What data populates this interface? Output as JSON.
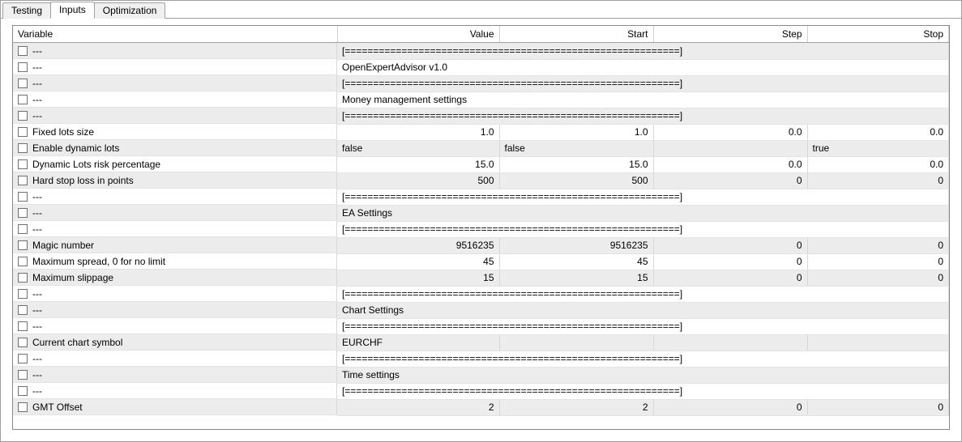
{
  "tabs": [
    {
      "label": "Testing",
      "active": false
    },
    {
      "label": "Inputs",
      "active": true
    },
    {
      "label": "Optimization",
      "active": false
    }
  ],
  "headers": {
    "variable": "Variable",
    "value": "Value",
    "start": "Start",
    "step": "Step",
    "stop": "Stop"
  },
  "sep": "[===========================================================]",
  "rows": [
    {
      "type": "sep",
      "variable": "---"
    },
    {
      "type": "text",
      "variable": "---",
      "value": "OpenExpertAdvisor v1.0"
    },
    {
      "type": "sep",
      "variable": "---"
    },
    {
      "type": "text",
      "variable": "---",
      "value": "Money management settings"
    },
    {
      "type": "sep",
      "variable": "---"
    },
    {
      "type": "num",
      "variable": "Fixed lots size",
      "value": "1.0",
      "start": "1.0",
      "step": "0.0",
      "stop": "0.0"
    },
    {
      "type": "bool",
      "variable": "Enable dynamic lots",
      "value": "false",
      "start": "false",
      "step": "",
      "stop": "true"
    },
    {
      "type": "num",
      "variable": "Dynamic Lots risk percentage",
      "value": "15.0",
      "start": "15.0",
      "step": "0.0",
      "stop": "0.0"
    },
    {
      "type": "num",
      "variable": "Hard stop loss in points",
      "value": "500",
      "start": "500",
      "step": "0",
      "stop": "0"
    },
    {
      "type": "sep",
      "variable": "---"
    },
    {
      "type": "text",
      "variable": "---",
      "value": "EA Settings"
    },
    {
      "type": "sep",
      "variable": "---"
    },
    {
      "type": "num",
      "variable": "Magic number",
      "value": "9516235",
      "start": "9516235",
      "step": "0",
      "stop": "0"
    },
    {
      "type": "num",
      "variable": "Maximum spread, 0 for no limit",
      "value": "45",
      "start": "45",
      "step": "0",
      "stop": "0"
    },
    {
      "type": "num",
      "variable": "Maximum slippage",
      "value": "15",
      "start": "15",
      "step": "0",
      "stop": "0"
    },
    {
      "type": "sep",
      "variable": "---"
    },
    {
      "type": "text",
      "variable": "---",
      "value": "Chart Settings"
    },
    {
      "type": "sep",
      "variable": "---"
    },
    {
      "type": "string",
      "variable": "Current chart symbol",
      "value": "EURCHF",
      "start": "",
      "step": "",
      "stop": ""
    },
    {
      "type": "sep",
      "variable": "---"
    },
    {
      "type": "text",
      "variable": "---",
      "value": "Time settings"
    },
    {
      "type": "sep",
      "variable": "---"
    },
    {
      "type": "num",
      "variable": "GMT Offset",
      "value": "2",
      "start": "2",
      "step": "0",
      "stop": "0"
    }
  ]
}
